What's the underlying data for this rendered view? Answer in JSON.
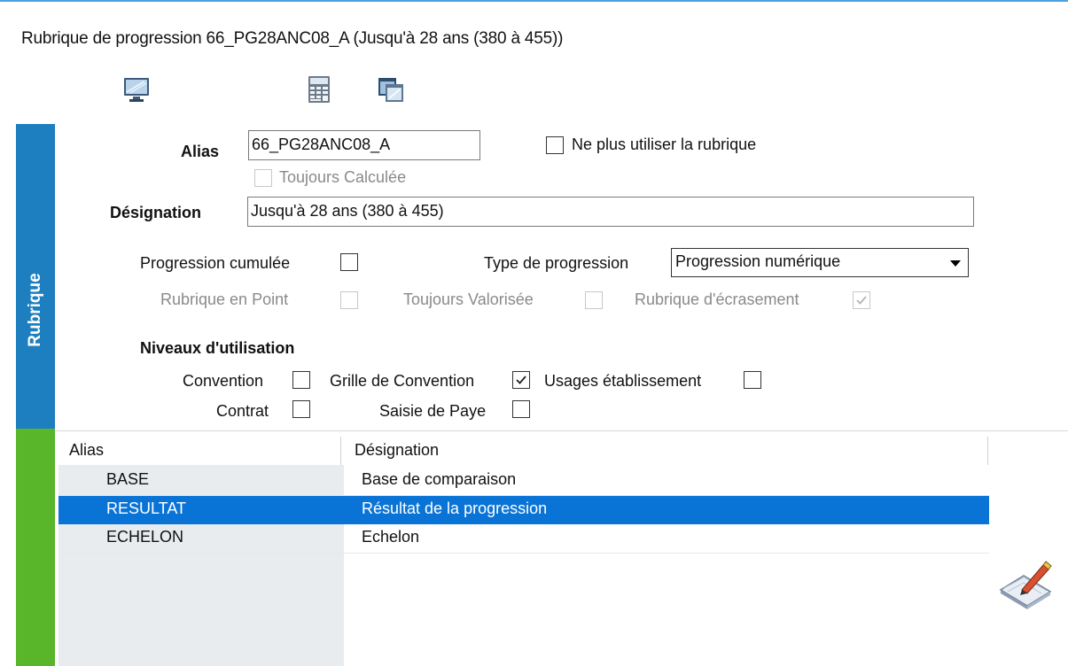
{
  "header": {
    "title": "Rubrique de progression 66_PG28ANC08_A (Jusqu'à 28 ans (380 à 455))",
    "toolbar_icons": [
      "monitor-icon",
      "calculator-icon",
      "window-copy-icon"
    ]
  },
  "section_label": "Rubrique",
  "form": {
    "alias_label": "Alias",
    "alias_value": "66_PG28ANC08_A",
    "ne_plus_utiliser_label": "Ne plus utiliser la rubrique",
    "ne_plus_utiliser_checked": false,
    "toujours_calculee_label": "Toujours Calculée",
    "toujours_calculee_checked": false,
    "designation_label": "Désignation",
    "designation_value": "Jusqu'à 28 ans (380 à 455)",
    "progression_cumulee_label": "Progression cumulée",
    "progression_cumulee_checked": false,
    "type_progression_label": "Type de progression",
    "type_progression_value": "Progression numérique",
    "rubrique_en_point_label": "Rubrique en Point",
    "toujours_valorisee_label": "Toujours Valorisée",
    "rubrique_ecrasement_label": "Rubrique d'écrasement",
    "rubrique_ecrasement_checked": true
  },
  "niveaux": {
    "heading": "Niveaux d'utilisation",
    "convention_label": "Convention",
    "convention_checked": false,
    "grille_label": "Grille de Convention",
    "grille_checked": true,
    "usages_label": "Usages établissement",
    "usages_checked": false,
    "contrat_label": "Contrat",
    "contrat_checked": false,
    "saisie_label": "Saisie de Paye",
    "saisie_checked": false
  },
  "table": {
    "columns": [
      "Alias",
      "Désignation"
    ],
    "rows": [
      {
        "alias": "BASE",
        "designation": "Base de comparaison",
        "selected": false
      },
      {
        "alias": "RESULTAT",
        "designation": "Résultat de la progression",
        "selected": true
      },
      {
        "alias": "ECHELON",
        "designation": "Echelon",
        "selected": false
      }
    ]
  },
  "edit_icon": "edit-document-icon",
  "colors": {
    "section_blue": "#1d7fbf",
    "section_green": "#59b52a",
    "selection": "#0a74d6"
  }
}
